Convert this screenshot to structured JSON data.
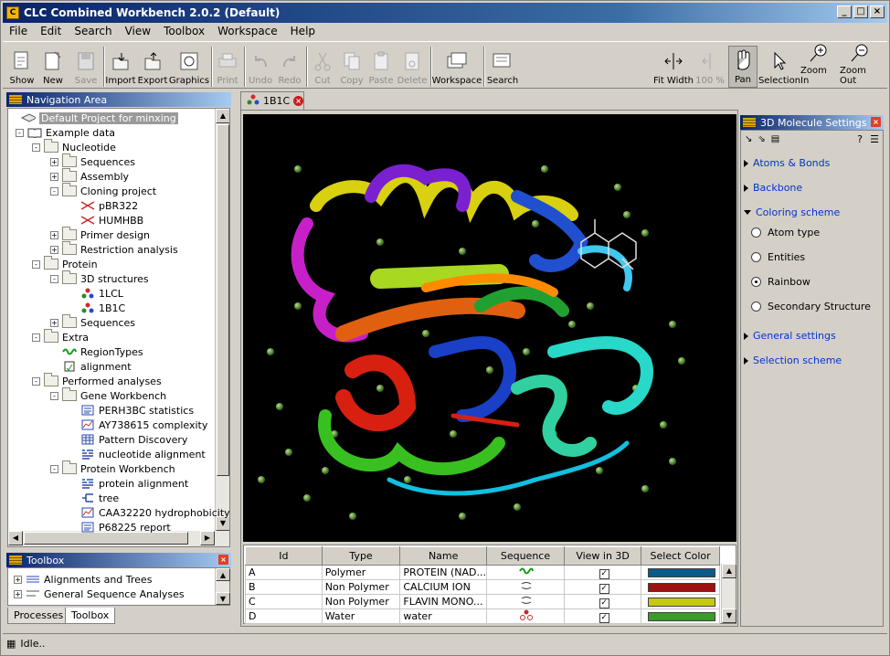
{
  "window": {
    "title": "CLC Combined Workbench 2.0.2 (Default)"
  },
  "menu": [
    "File",
    "Edit",
    "Search",
    "View",
    "Toolbox",
    "Workspace",
    "Help"
  ],
  "toolbar": {
    "show": "Show",
    "new": "New",
    "save": "Save",
    "import": "Import",
    "export": "Export",
    "graphics": "Graphics",
    "print": "Print",
    "undo": "Undo",
    "redo": "Redo",
    "cut": "Cut",
    "copy": "Copy",
    "paste": "Paste",
    "delete": "Delete",
    "workspace": "Workspace",
    "search": "Search",
    "fit_width": "Fit Width",
    "zoom100": "100 %",
    "pan": "Pan",
    "selection": "Selection",
    "zoom_in": "Zoom In",
    "zoom_out": "Zoom Out"
  },
  "nav": {
    "title": "Navigation Area",
    "items": [
      {
        "label": "Default Project for minxing"
      },
      {
        "label": "Example data"
      },
      {
        "label": "Nucleotide"
      },
      {
        "label": "Sequences"
      },
      {
        "label": "Assembly"
      },
      {
        "label": "Cloning project"
      },
      {
        "label": "pBR322"
      },
      {
        "label": "HUMHBB"
      },
      {
        "label": "Primer design"
      },
      {
        "label": "Restriction analysis"
      },
      {
        "label": "Protein"
      },
      {
        "label": "3D structures"
      },
      {
        "label": "1LCL"
      },
      {
        "label": "1B1C"
      },
      {
        "label": "Sequences"
      },
      {
        "label": "Extra"
      },
      {
        "label": "RegionTypes"
      },
      {
        "label": "alignment"
      },
      {
        "label": "Performed analyses"
      },
      {
        "label": "Gene Workbench"
      },
      {
        "label": "PERH3BC statistics"
      },
      {
        "label": "AY738615 complexity"
      },
      {
        "label": "Pattern Discovery"
      },
      {
        "label": "nucleotide alignment"
      },
      {
        "label": "Protein Workbench"
      },
      {
        "label": "protein alignment"
      },
      {
        "label": "tree"
      },
      {
        "label": "CAA32220 hydrophobicity"
      },
      {
        "label": "P68225 report"
      }
    ]
  },
  "toolbox": {
    "title": "Toolbox",
    "items": [
      "Alignments and Trees",
      "General Sequence Analyses"
    ],
    "tabs": [
      "Processes",
      "Toolbox"
    ]
  },
  "editor": {
    "tab": "1B1C",
    "table": {
      "headers": [
        "Id",
        "Type",
        "Name",
        "Sequence",
        "View in 3D",
        "Select Color"
      ],
      "rows": [
        {
          "id": "A",
          "type": "Polymer",
          "name": "PROTEIN (NAD...",
          "color": "#0a5a8a"
        },
        {
          "id": "B",
          "type": "Non Polymer",
          "name": "CALCIUM ION",
          "color": "#a01010"
        },
        {
          "id": "C",
          "type": "Non Polymer",
          "name": "FLAVIN MONO...",
          "color": "#c8c814"
        },
        {
          "id": "D",
          "type": "Water",
          "name": "water",
          "color": "#3a9a2a"
        }
      ]
    }
  },
  "settings": {
    "title": "3D Molecule Settings",
    "sections": [
      "Atoms & Bonds",
      "Backbone",
      "Coloring scheme",
      "General settings",
      "Selection scheme"
    ],
    "coloring_options": [
      "Atom type",
      "Entities",
      "Rainbow",
      "Secondary Structure"
    ],
    "selected": "Rainbow"
  },
  "status": {
    "text": "Idle.."
  }
}
